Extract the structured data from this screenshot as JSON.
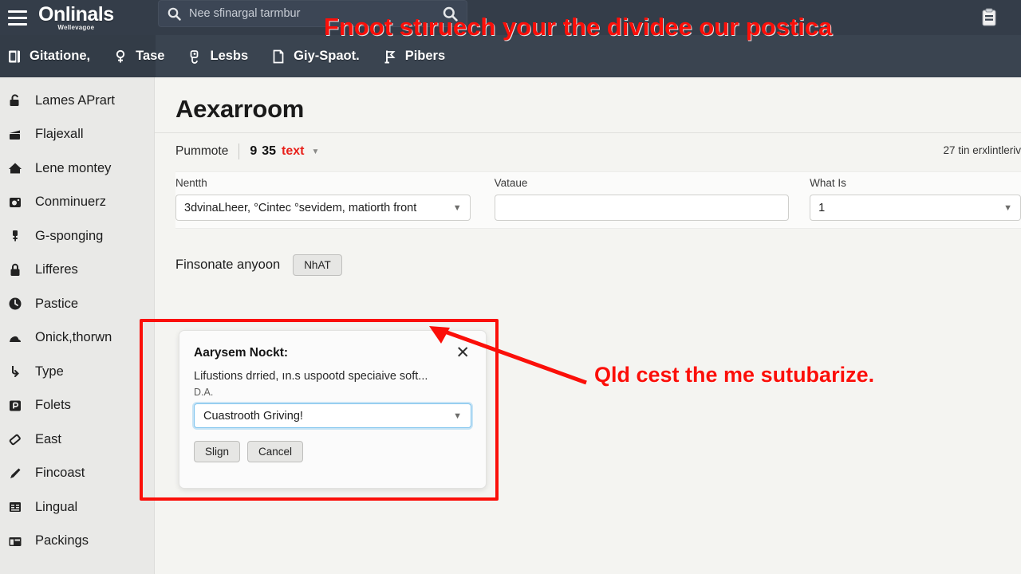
{
  "header": {
    "menu_icon": "hamburger-icon",
    "brand": "Onlinals",
    "brand_sub": "Wellevagoe",
    "search_placeholder": "Nee sfinargal tarmbur",
    "search_value": "",
    "search_icon": "search-icon",
    "search_submit_icon": "search-icon",
    "right_icon": "clipboard-icon"
  },
  "nav": {
    "items": [
      {
        "label": "Gitatione,",
        "icon": "book-icon"
      },
      {
        "label": "Tase",
        "icon": "person-icon"
      },
      {
        "label": "Lesbs",
        "icon": "tag-icon"
      },
      {
        "label": "Giy-Spaot.",
        "icon": "document-icon"
      },
      {
        "label": "Pibers",
        "icon": "flag-icon"
      }
    ]
  },
  "sidebar": {
    "items": [
      {
        "label": "Lames APrart",
        "icon": "lock-open-icon"
      },
      {
        "label": "Flajexall",
        "icon": "clapper-icon"
      },
      {
        "label": "Lene montey",
        "icon": "home-icon"
      },
      {
        "label": "Conminuerz",
        "icon": "camera-icon"
      },
      {
        "label": "G-sponging",
        "icon": "pin-icon"
      },
      {
        "label": "Lifferes",
        "icon": "lock-icon"
      },
      {
        "label": "Pastice",
        "icon": "clock-icon"
      },
      {
        "label": "Onick,thorwn",
        "icon": "cloud-icon"
      },
      {
        "label": "Type",
        "icon": "download-icon"
      },
      {
        "label": "Folets",
        "icon": "parking-icon"
      },
      {
        "label": "East",
        "icon": "eraser-icon"
      },
      {
        "label": "Fincoast",
        "icon": "pencil-icon"
      },
      {
        "label": "Lingual",
        "icon": "table-icon"
      },
      {
        "label": "Packings",
        "icon": "window-icon"
      }
    ]
  },
  "main": {
    "page_title": "Aexarroom",
    "meta": {
      "label": "Pummote",
      "num1": "9",
      "num2": "35",
      "red_text": "text",
      "caret_icon": "chevron-down-icon",
      "right_text": "27 tin erxlintleriv"
    },
    "fields": [
      {
        "label": "Nentth",
        "value": "3dvinaLheer, °Cintec °sevidem, matiorth front",
        "caret_icon": "chevron-down-icon",
        "type": "select"
      },
      {
        "label": "Vataue",
        "value": "",
        "type": "text"
      },
      {
        "label": "What Is",
        "value": "1",
        "caret_icon": "chevron-down-icon",
        "type": "select"
      }
    ],
    "assign": {
      "label": "Finsonate anyoon",
      "button": "NhAT"
    }
  },
  "modal": {
    "title": "Aarysem Nockt:",
    "close_icon": "close-icon",
    "text": "Lifustions drried, ın.s uspootd speciaive soft...",
    "subtext": "D.A.",
    "select_value": "Cuastrooth Griving!",
    "select_caret_icon": "chevron-down-icon",
    "confirm_button": "Slign",
    "cancel_button": "Cancel"
  },
  "annotations": {
    "headline": "Fnoot stıruech your the dividee our postica",
    "note": "Qld cest the me sutubarize.",
    "box_color": "#fb0f09",
    "arrow_color": "#fb0f09"
  }
}
